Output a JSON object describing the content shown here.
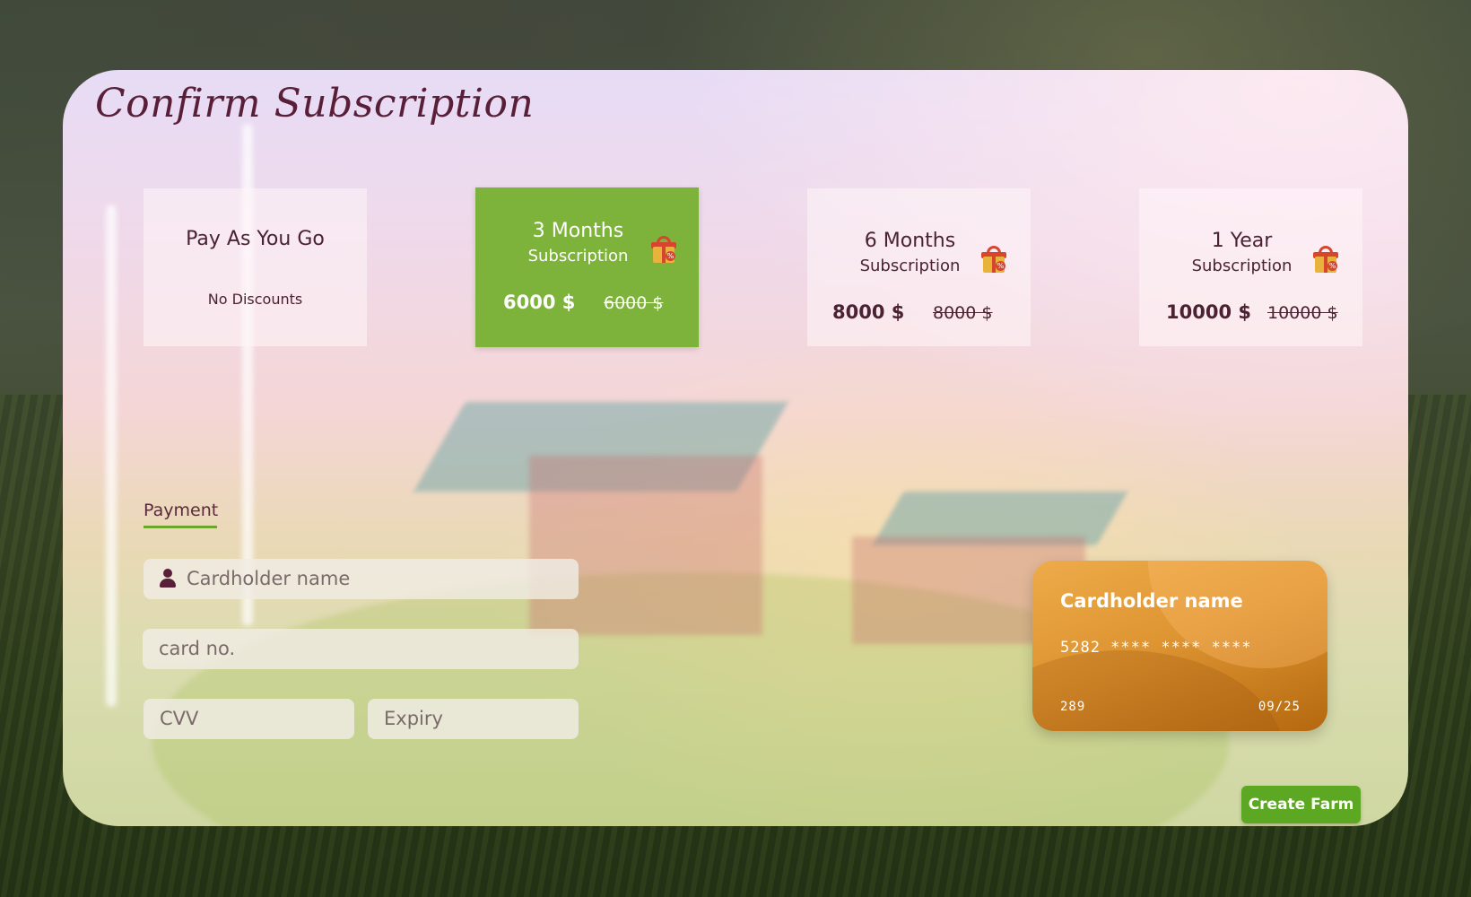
{
  "page": {
    "title": "Confirm Subscription"
  },
  "plans": [
    {
      "name": "Pay As You Go",
      "subtitle": "",
      "note": "No Discounts",
      "price": "",
      "old_price": "",
      "selected": false
    },
    {
      "name": "3 Months",
      "subtitle": "Subscription",
      "note": "",
      "price": "6000 $",
      "old_price": "6000 $",
      "selected": true
    },
    {
      "name": "6 Months",
      "subtitle": "Subscription",
      "note": "",
      "price": "8000 $",
      "old_price": "8000 $",
      "selected": false
    },
    {
      "name": "1 Year",
      "subtitle": "Subscription",
      "note": "",
      "price": "10000 $",
      "old_price": "10000 $",
      "selected": false
    }
  ],
  "payment": {
    "tab_label": "Payment",
    "cardholder_placeholder": "Cardholder name",
    "card_no_placeholder": "card no.",
    "cvv_placeholder": "CVV",
    "expiry_placeholder": "Expiry"
  },
  "card_preview": {
    "holder": "Cardholder name",
    "number": "5282 **** **** ****",
    "cvv": "289",
    "expiry": "09/25"
  },
  "actions": {
    "create_label": "Create Farm"
  },
  "colors": {
    "accent": "#7db33a",
    "button": "#5da822",
    "title": "#5a1f38",
    "card": "#de9532"
  },
  "icons": {
    "gift": "gift-icon",
    "user": "user-icon"
  }
}
